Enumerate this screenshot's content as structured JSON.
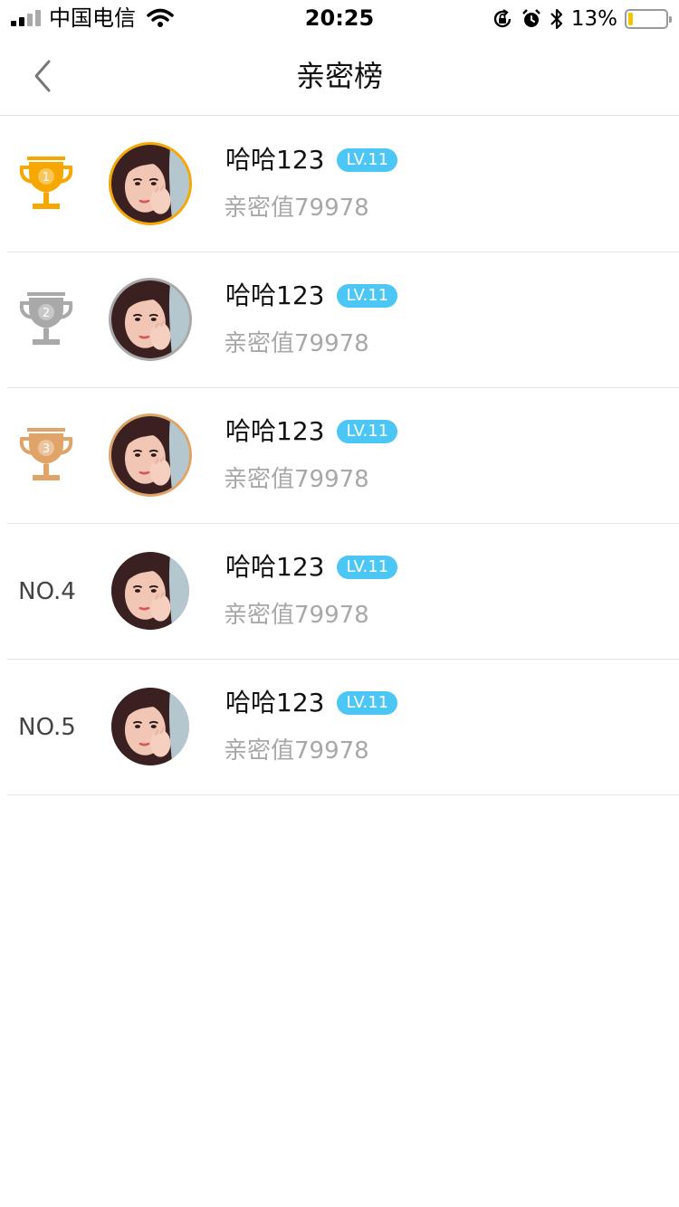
{
  "status_bar": {
    "carrier": "中国电信",
    "time": "20:25",
    "battery_percent": "13%",
    "battery_level": 0.13,
    "battery_color": "#f5c300",
    "icons": [
      "signal-icon",
      "wifi-icon",
      "orientation-lock-icon",
      "alarm-icon",
      "bluetooth-icon",
      "battery-icon"
    ]
  },
  "nav": {
    "title": "亲密榜",
    "back_icon": "chevron-left-icon"
  },
  "colors": {
    "gold": "#f7a800",
    "silver": "#a9a9a9",
    "bronze": "#e0a468",
    "level_badge": "#4cc6f5",
    "muted_text": "#a8a8a8"
  },
  "ranking": [
    {
      "rank_number": "1",
      "rank_label": "",
      "trophy": "gold-trophy-icon",
      "name": "哈哈123",
      "level": "LV.11",
      "intimacy": "亲密值79978"
    },
    {
      "rank_number": "2",
      "rank_label": "",
      "trophy": "silver-trophy-icon",
      "name": "哈哈123",
      "level": "LV.11",
      "intimacy": "亲密值79978"
    },
    {
      "rank_number": "3",
      "rank_label": "",
      "trophy": "bronze-trophy-icon",
      "name": "哈哈123",
      "level": "LV.11",
      "intimacy": "亲密值79978"
    },
    {
      "rank_number": "4",
      "rank_label": "NO.4",
      "trophy": "",
      "name": "哈哈123",
      "level": "LV.11",
      "intimacy": "亲密值79978"
    },
    {
      "rank_number": "5",
      "rank_label": "NO.5",
      "trophy": "",
      "name": "哈哈123",
      "level": "LV.11",
      "intimacy": "亲密值79978"
    }
  ]
}
